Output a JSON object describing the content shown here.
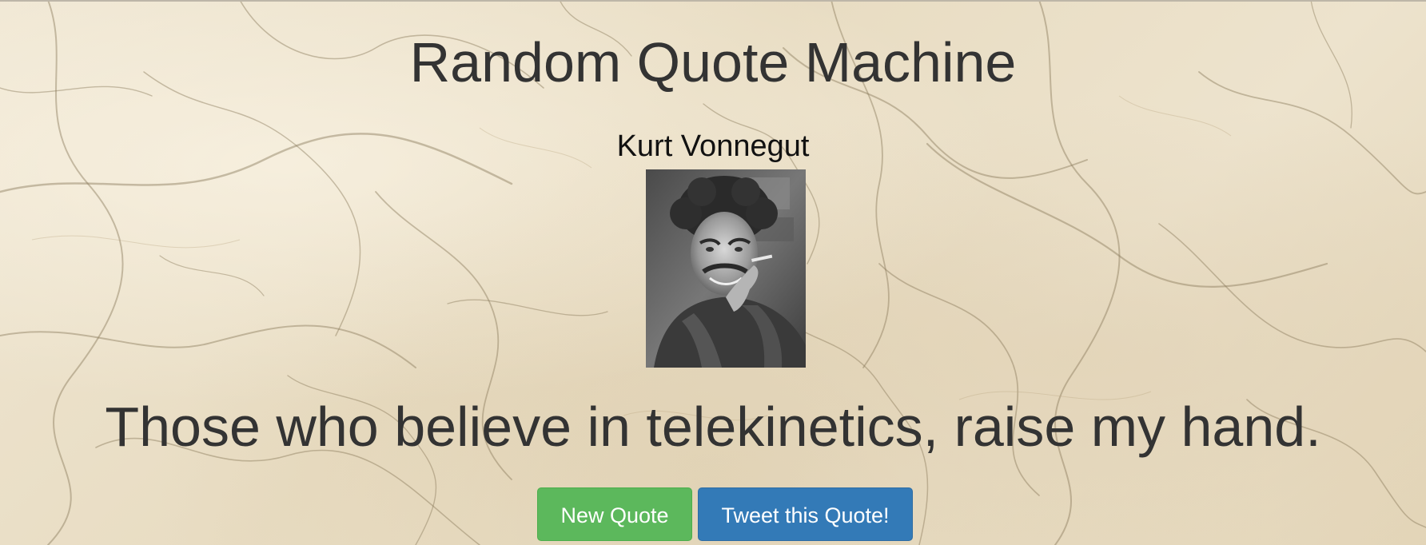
{
  "page": {
    "title": "Random Quote Machine"
  },
  "quote": {
    "author": "Kurt Vonnegut",
    "text": "Those who believe in telekinetics, raise my hand.",
    "portrait_alt": "Kurt Vonnegut portrait"
  },
  "actions": {
    "new_quote_label": "New Quote",
    "tweet_label": "Tweet this Quote!"
  },
  "colors": {
    "new_quote_button": "#5cb85c",
    "tweet_button": "#337ab7",
    "heading_text": "#333333",
    "background": "#ece2cd"
  }
}
